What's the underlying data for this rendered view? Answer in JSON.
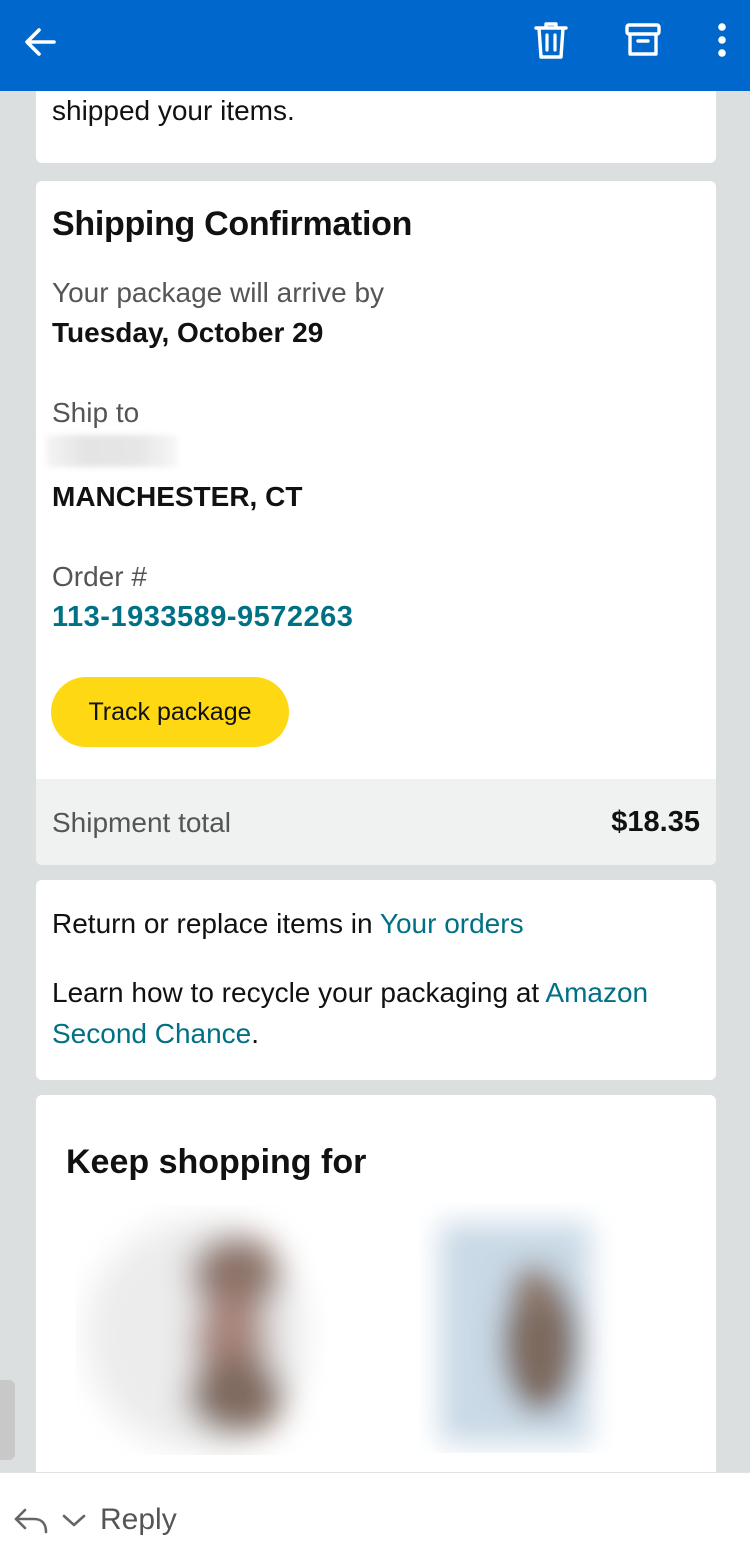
{
  "header": {
    "back_icon": "arrow-left-icon",
    "delete_icon": "trash-icon",
    "archive_icon": "archive-box-icon",
    "more_icon": "more-vertical-icon",
    "background_color": "#0067cc"
  },
  "email": {
    "intro_tail": "shipped your items.",
    "shipping": {
      "title": "Shipping Confirmation",
      "arrive_label": "Your package will arrive by",
      "arrive_date": "Tuesday, October 29",
      "ship_to_label": "Ship to",
      "ship_to_city": "MANCHESTER, CT",
      "order_label": "Order #",
      "order_number": "113-1933589-9572263",
      "track_button": "Track package",
      "total_label": "Shipment total",
      "total_value": "$18.35"
    },
    "returns": {
      "return_prefix": "Return or replace items in ",
      "return_link": "Your orders",
      "recycle_prefix": "Learn how to recycle your packaging at ",
      "recycle_link": "Amazon Second Chance",
      "recycle_suffix": "."
    },
    "keep_shopping": {
      "title": "Keep shopping for"
    }
  },
  "footer": {
    "reply_icon": "reply-arrow-icon",
    "dropdown_icon": "chevron-down-icon",
    "reply_label": "Reply"
  },
  "colors": {
    "accent_link": "#007185",
    "button_yellow": "#ffd814"
  }
}
